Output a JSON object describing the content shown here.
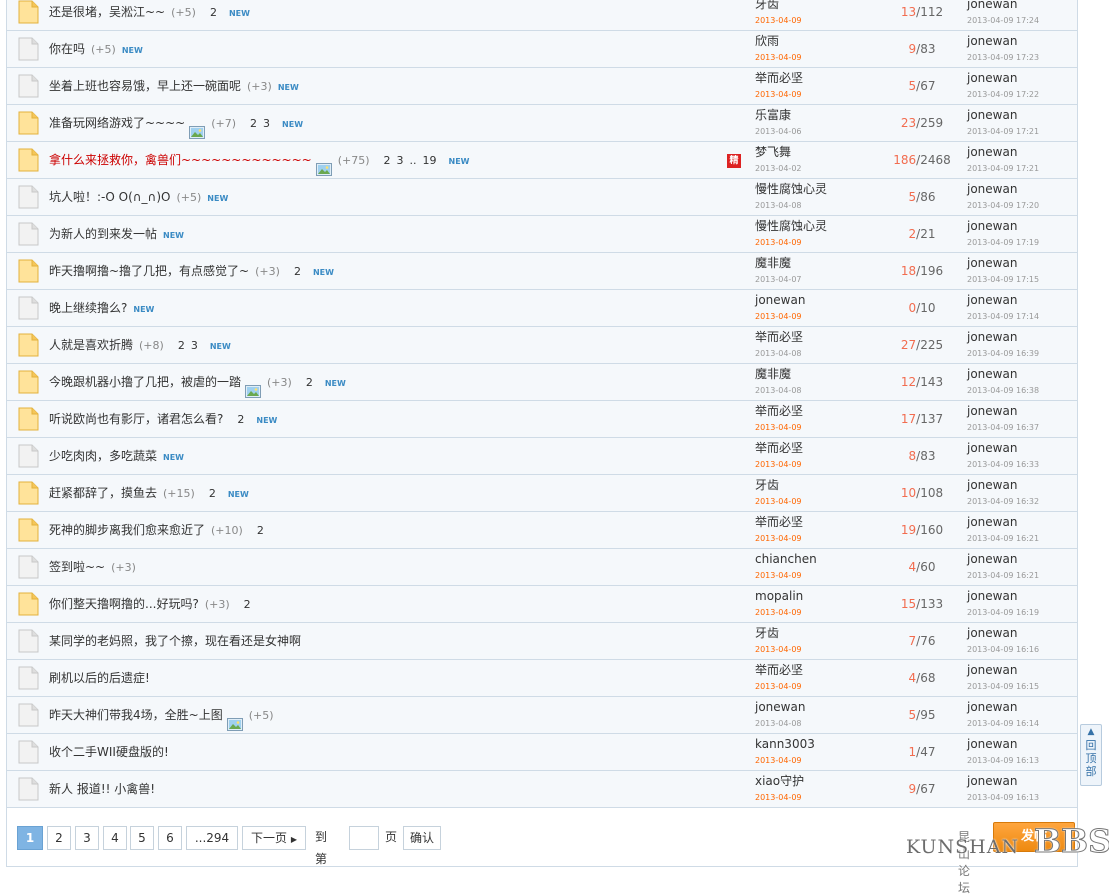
{
  "threads": [
    {
      "title": "还是很堵，吴淞江~~",
      "hot": false,
      "pic": false,
      "bonus": "(+5)",
      "pages": [
        "2"
      ],
      "isnew": true,
      "folder": "yellow",
      "stamp": "",
      "author": "牙齿",
      "date": "2013-04-09",
      "today": true,
      "replies": "13",
      "views": "112",
      "last_author": "jonewan",
      "last_time": "2013-04-09 17:24"
    },
    {
      "title": "你在吗",
      "hot": false,
      "pic": false,
      "bonus": "(+5)",
      "pages": [],
      "isnew": true,
      "folder": "gray",
      "stamp": "",
      "author": "欣雨",
      "date": "2013-04-09",
      "today": true,
      "replies": "9",
      "views": "83",
      "last_author": "jonewan",
      "last_time": "2013-04-09 17:23"
    },
    {
      "title": "坐着上班也容易饿，早上还一碗面呢",
      "hot": false,
      "pic": false,
      "bonus": "(+3)",
      "pages": [],
      "isnew": true,
      "folder": "gray",
      "stamp": "",
      "author": "举而必坚",
      "date": "2013-04-09",
      "today": true,
      "replies": "5",
      "views": "67",
      "last_author": "jonewan",
      "last_time": "2013-04-09 17:22"
    },
    {
      "title": "准备玩网络游戏了~~~~",
      "hot": false,
      "pic": true,
      "bonus": "(+7)",
      "pages": [
        "2",
        "3"
      ],
      "isnew": true,
      "folder": "yellow",
      "stamp": "",
      "author": "乐富康",
      "date": "2013-04-06",
      "today": false,
      "replies": "23",
      "views": "259",
      "last_author": "jonewan",
      "last_time": "2013-04-09 17:21"
    },
    {
      "title": "拿什么来拯救你，禽兽们~~~~~~~~~~~~~",
      "hot": true,
      "pic": true,
      "bonus": "(+75)",
      "pages": [
        "2",
        "3",
        "..",
        "19"
      ],
      "isnew": true,
      "folder": "yellow",
      "stamp": "精",
      "author": "梦飞舞",
      "date": "2013-04-02",
      "today": false,
      "replies": "186",
      "views": "2468",
      "last_author": "jonewan",
      "last_time": "2013-04-09 17:21"
    },
    {
      "title": "坑人啦！:-O O(∩_∩)O",
      "hot": false,
      "pic": false,
      "bonus": "(+5)",
      "pages": [],
      "isnew": true,
      "folder": "gray",
      "stamp": "",
      "author": "慢性腐蚀心灵",
      "date": "2013-04-08",
      "today": false,
      "replies": "5",
      "views": "86",
      "last_author": "jonewan",
      "last_time": "2013-04-09 17:20"
    },
    {
      "title": "为新人的到来发一帖",
      "hot": false,
      "pic": false,
      "bonus": "",
      "pages": [],
      "isnew": true,
      "folder": "gray",
      "stamp": "",
      "author": "慢性腐蚀心灵",
      "date": "2013-04-09",
      "today": true,
      "replies": "2",
      "views": "21",
      "last_author": "jonewan",
      "last_time": "2013-04-09 17:19"
    },
    {
      "title": "昨天撸啊撸~撸了几把，有点感觉了~",
      "hot": false,
      "pic": false,
      "bonus": "(+3)",
      "pages": [
        "2"
      ],
      "isnew": true,
      "folder": "yellow",
      "stamp": "",
      "author": "魔非魔",
      "date": "2013-04-07",
      "today": false,
      "replies": "18",
      "views": "196",
      "last_author": "jonewan",
      "last_time": "2013-04-09 17:15"
    },
    {
      "title": "晚上继续撸么?",
      "hot": false,
      "pic": false,
      "bonus": "",
      "pages": [],
      "isnew": true,
      "folder": "gray",
      "stamp": "",
      "author": "jonewan",
      "date": "2013-04-09",
      "today": true,
      "replies": "0",
      "views": "10",
      "last_author": "jonewan",
      "last_time": "2013-04-09 17:14"
    },
    {
      "title": "人就是喜欢折腾",
      "hot": false,
      "pic": false,
      "bonus": "(+8)",
      "pages": [
        "2",
        "3"
      ],
      "isnew": true,
      "folder": "yellow",
      "stamp": "",
      "author": "举而必坚",
      "date": "2013-04-08",
      "today": false,
      "replies": "27",
      "views": "225",
      "last_author": "jonewan",
      "last_time": "2013-04-09 16:39"
    },
    {
      "title": "今晚跟机器小撸了几把，被虐的一踏",
      "hot": false,
      "pic": true,
      "bonus": "(+3)",
      "pages": [
        "2"
      ],
      "isnew": true,
      "folder": "yellow",
      "stamp": "",
      "author": "魔非魔",
      "date": "2013-04-08",
      "today": false,
      "replies": "12",
      "views": "143",
      "last_author": "jonewan",
      "last_time": "2013-04-09 16:38"
    },
    {
      "title": "听说欧尚也有影厅，诸君怎么看?",
      "hot": false,
      "pic": false,
      "bonus": "",
      "pages": [
        "2"
      ],
      "isnew": true,
      "folder": "yellow",
      "stamp": "",
      "author": "举而必坚",
      "date": "2013-04-09",
      "today": true,
      "replies": "17",
      "views": "137",
      "last_author": "jonewan",
      "last_time": "2013-04-09 16:37"
    },
    {
      "title": "少吃肉肉，多吃蔬菜",
      "hot": false,
      "pic": false,
      "bonus": "",
      "pages": [],
      "isnew": true,
      "folder": "gray",
      "stamp": "",
      "author": "举而必坚",
      "date": "2013-04-09",
      "today": true,
      "replies": "8",
      "views": "83",
      "last_author": "jonewan",
      "last_time": "2013-04-09 16:33"
    },
    {
      "title": "赶紧都辞了，摸鱼去",
      "hot": false,
      "pic": false,
      "bonus": "(+15)",
      "pages": [
        "2"
      ],
      "isnew": true,
      "folder": "yellow",
      "stamp": "",
      "author": "牙齿",
      "date": "2013-04-09",
      "today": true,
      "replies": "10",
      "views": "108",
      "last_author": "jonewan",
      "last_time": "2013-04-09 16:32"
    },
    {
      "title": "死神的脚步离我们愈来愈近了",
      "hot": false,
      "pic": false,
      "bonus": "(+10)",
      "pages": [
        "2"
      ],
      "isnew": false,
      "folder": "yellow",
      "stamp": "",
      "author": "举而必坚",
      "date": "2013-04-09",
      "today": true,
      "replies": "19",
      "views": "160",
      "last_author": "jonewan",
      "last_time": "2013-04-09 16:21"
    },
    {
      "title": "签到啦~~",
      "hot": false,
      "pic": false,
      "bonus": "(+3)",
      "pages": [],
      "isnew": false,
      "folder": "gray",
      "stamp": "",
      "author": "chianchen",
      "date": "2013-04-09",
      "today": true,
      "replies": "4",
      "views": "60",
      "last_author": "jonewan",
      "last_time": "2013-04-09 16:21"
    },
    {
      "title": "你们整天撸啊撸的...好玩吗?",
      "hot": false,
      "pic": false,
      "bonus": "(+3)",
      "pages": [
        "2"
      ],
      "isnew": false,
      "folder": "yellow",
      "stamp": "",
      "author": "mopalin",
      "date": "2013-04-09",
      "today": true,
      "replies": "15",
      "views": "133",
      "last_author": "jonewan",
      "last_time": "2013-04-09 16:19"
    },
    {
      "title": "某同学的老妈照，我了个擦，现在看还是女神啊",
      "hot": false,
      "pic": false,
      "bonus": "",
      "pages": [],
      "isnew": false,
      "folder": "gray",
      "stamp": "",
      "author": "牙齿",
      "date": "2013-04-09",
      "today": true,
      "replies": "7",
      "views": "76",
      "last_author": "jonewan",
      "last_time": "2013-04-09 16:16"
    },
    {
      "title": "刷机以后的后遗症!",
      "hot": false,
      "pic": false,
      "bonus": "",
      "pages": [],
      "isnew": false,
      "folder": "gray",
      "stamp": "",
      "author": "举而必坚",
      "date": "2013-04-09",
      "today": true,
      "replies": "4",
      "views": "68",
      "last_author": "jonewan",
      "last_time": "2013-04-09 16:15"
    },
    {
      "title": "昨天大神们带我4场，全胜~上图",
      "hot": false,
      "pic": true,
      "bonus": "(+5)",
      "pages": [],
      "isnew": false,
      "folder": "gray",
      "stamp": "",
      "author": "jonewan",
      "date": "2013-04-08",
      "today": false,
      "replies": "5",
      "views": "95",
      "last_author": "jonewan",
      "last_time": "2013-04-09 16:14"
    },
    {
      "title": "收个二手WII硬盘版的!",
      "hot": false,
      "pic": false,
      "bonus": "",
      "pages": [],
      "isnew": false,
      "folder": "gray",
      "stamp": "",
      "author": "kann3003",
      "date": "2013-04-09",
      "today": true,
      "replies": "1",
      "views": "47",
      "last_author": "jonewan",
      "last_time": "2013-04-09 16:13"
    },
    {
      "title": "新人 报道!! 小禽兽!",
      "hot": false,
      "pic": false,
      "bonus": "",
      "pages": [],
      "isnew": false,
      "folder": "gray",
      "stamp": "",
      "author": "xiao守护",
      "date": "2013-04-09",
      "today": true,
      "replies": "9",
      "views": "67",
      "last_author": "jonewan",
      "last_time": "2013-04-09 16:13"
    }
  ],
  "ui": {
    "new_label": "NEW",
    "views_sep": "/"
  },
  "pager": {
    "pages": [
      "1",
      "2",
      "3",
      "4",
      "5",
      "6"
    ],
    "current": "1",
    "last": "...294",
    "next": "下一页",
    "goto_label": "到第",
    "page_unit": "页",
    "confirm": "确认"
  },
  "side": {
    "back_to_top": "回顶部",
    "new_post": "发帖"
  },
  "watermark": {
    "cn": "昆山论坛",
    "en": "KUNSHAN",
    "bbs": "BBS"
  },
  "colors": {
    "row_bg": "#f5f8fb",
    "border": "#cfdbe6",
    "reply_count": "#f26c4f",
    "today_date": "#f60",
    "hot_title": "#cc0000",
    "new_tag": "#3b8bc4"
  }
}
